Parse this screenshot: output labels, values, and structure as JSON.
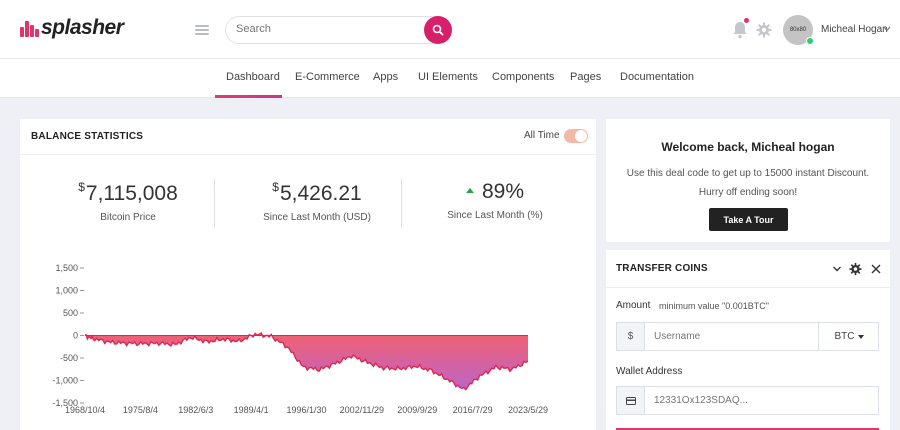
{
  "brand": {
    "logo_text": "splasher",
    "accent": "#d8206a"
  },
  "header": {
    "search_placeholder": "Search",
    "avatar_text": "80x80",
    "user_name": "Micheal Hogan"
  },
  "nav": {
    "tabs": [
      {
        "label": "Dashboard",
        "active": true
      },
      {
        "label": "E-Commerce"
      },
      {
        "label": "Apps"
      },
      {
        "label": "UI Elements"
      },
      {
        "label": "Components"
      },
      {
        "label": "Pages"
      },
      {
        "label": "Documentation"
      }
    ]
  },
  "balance": {
    "title": "BALANCE STATISTICS",
    "toggle_label": "All Time",
    "toggle_on": true,
    "stats": [
      {
        "prefix": "$",
        "value": "7,115,008",
        "label": "Bitcoin Price"
      },
      {
        "prefix": "$",
        "value": "5,426.21",
        "label": "Since Last Month (USD)"
      },
      {
        "prefix": "",
        "value": "89%",
        "label": "Since Last Month (%)",
        "trend": "up"
      }
    ]
  },
  "chart_data": {
    "type": "area",
    "title": "",
    "xlabel": "",
    "ylabel": "",
    "ylim": [
      -1500,
      1500
    ],
    "yticks": [
      1500,
      1000,
      500,
      0,
      -500,
      -1000,
      -1500
    ],
    "ytick_labels": [
      "1,500",
      "1,000",
      "500",
      "0",
      "-500",
      "-1,000",
      "-1,500"
    ],
    "xtick_labels": [
      "1968/10/4",
      "1975/8/4",
      "1982/6/3",
      "1989/4/1",
      "1996/1/30",
      "2002/11/29",
      "2009/9/29",
      "2016/7/29",
      "2023/5/29"
    ],
    "x": [
      1968.8,
      1970,
      1972,
      1974,
      1976,
      1978,
      1980,
      1982,
      1984,
      1986,
      1988,
      1990,
      1992,
      1994,
      1996,
      1998,
      2000,
      2002,
      2004,
      2006,
      2008,
      2010,
      2012,
      2014,
      2016,
      2018,
      2020,
      2022,
      2024
    ],
    "values": [
      -10,
      -80,
      -150,
      -170,
      -180,
      -170,
      -200,
      -40,
      -140,
      -80,
      -130,
      30,
      -20,
      -250,
      -700,
      -760,
      -620,
      -450,
      -600,
      -720,
      -740,
      -680,
      -780,
      -980,
      -1200,
      -900,
      -700,
      -750,
      -570
    ],
    "colors": {
      "top": "#f0586a",
      "bottom": "#b85cc4",
      "line": "#e3244f"
    }
  },
  "welcome": {
    "title": "Welcome back, Micheal hogan",
    "text": "Use this deal code to get up to 15000 instant Discount. Hurry off ending soon!",
    "button": "Take A Tour"
  },
  "transfer": {
    "title": "TRANSFER COINS",
    "amount_label": "Amount",
    "amount_hint": "minimum value \"0.001BTC\"",
    "currency_symbol": "$",
    "username_placeholder": "Username",
    "coin": "BTC",
    "wallet_label": "Wallet Address",
    "wallet_placeholder": "12331Ox123SDAQ..."
  }
}
